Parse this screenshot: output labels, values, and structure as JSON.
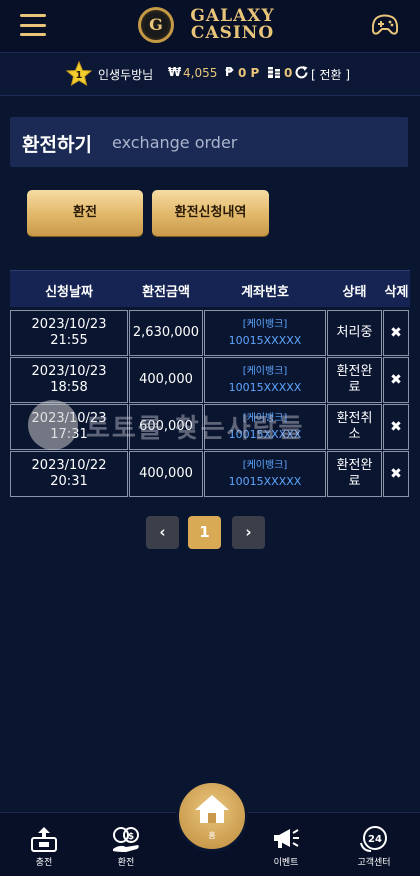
{
  "header": {
    "logo_letter": "G",
    "logo_line1": "GALAXY",
    "logo_line2": "CASINO"
  },
  "user": {
    "level": "1",
    "name": "인생두방님",
    "won_symbol": "₩",
    "balance": "4,055",
    "point_symbol": "₱",
    "points": "0 P",
    "coin": "0",
    "convert_label": "[ 전환 ]"
  },
  "page": {
    "title": "환전하기",
    "subtitle": "exchange order"
  },
  "buttons": {
    "exchange": "환전",
    "history": "환전신청내역"
  },
  "table": {
    "headers": [
      "신청날짜",
      "환전금액",
      "계좌번호",
      "상태",
      "삭제"
    ],
    "rows": [
      {
        "date": "2023/10/23",
        "time": "21:55",
        "amount": "2,630,000",
        "bank": "[케이뱅크]",
        "account": "10015XXXXX",
        "status1": "처리중",
        "status2": "",
        "delete": "✖"
      },
      {
        "date": "2023/10/23",
        "time": "18:58",
        "amount": "400,000",
        "bank": "[케이뱅크]",
        "account": "10015XXXXX",
        "status1": "환전완",
        "status2": "료",
        "delete": "✖"
      },
      {
        "date": "2023/10/23",
        "time": "17:31",
        "amount": "600,000",
        "bank": "[케이뱅크]",
        "account": "10015XXXXX",
        "status1": "환전취",
        "status2": "소",
        "delete": "✖"
      },
      {
        "date": "2023/10/22",
        "time": "20:31",
        "amount": "400,000",
        "bank": "[케이뱅크]",
        "account": "10015XXXXX",
        "status1": "환전완",
        "status2": "료",
        "delete": "✖"
      }
    ]
  },
  "pagination": {
    "prev": "‹",
    "current": "1",
    "next": "›"
  },
  "watermark": {
    "text": "토토를 찾는사람들"
  },
  "bottom_nav": {
    "deposit": "충전",
    "exchange": "환전",
    "home": "홈",
    "event": "이벤트",
    "support": "고객센터",
    "support_badge": "24"
  },
  "colors": {
    "background": "#0a1530",
    "gold": "#e9c57a",
    "link_blue": "#5ea6ff"
  }
}
